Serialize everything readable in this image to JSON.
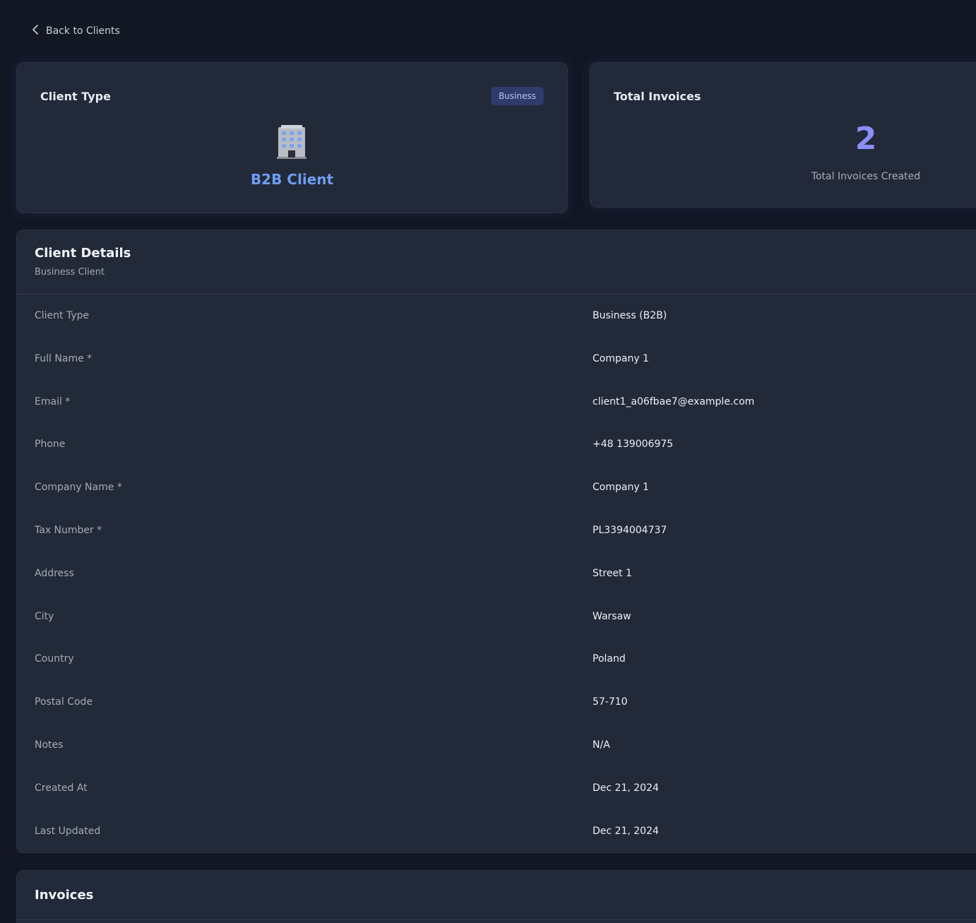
{
  "nav": {
    "back_label": "Back to Clients",
    "back_icon": "chevron-left-icon"
  },
  "client_type_card": {
    "title": "Client Type",
    "badge": "Business",
    "icon": "building-icon",
    "label": "B2B Client",
    "accent_color": "#6f9df0"
  },
  "invoices_card": {
    "title": "Total Invoices",
    "count": "2",
    "subtitle": "Total Invoices Created",
    "accent_color": "#8b8ef5"
  },
  "details": {
    "title": "Client Details",
    "subtitle": "Business Client",
    "rows": [
      {
        "label": "Client Type",
        "value": "Business (B2B)"
      },
      {
        "label": "Full Name *",
        "value": "Company 1"
      },
      {
        "label": "Email *",
        "value": "client1_a06fbae7@example.com"
      },
      {
        "label": "Phone",
        "value": "+48 139006975"
      },
      {
        "label": "Company Name *",
        "value": "Company 1"
      },
      {
        "label": "Tax Number *",
        "value": "PL3394004737"
      },
      {
        "label": "Address",
        "value": "Street 1"
      },
      {
        "label": "City",
        "value": "Warsaw"
      },
      {
        "label": "Country",
        "value": "Poland"
      },
      {
        "label": "Postal Code",
        "value": "57-710"
      },
      {
        "label": "Notes",
        "value": "N/A"
      },
      {
        "label": "Created At",
        "value": "Dec 21, 2024"
      },
      {
        "label": "Last Updated",
        "value": "Dec 21, 2024"
      }
    ]
  },
  "invoices_section": {
    "title": "Invoices"
  }
}
